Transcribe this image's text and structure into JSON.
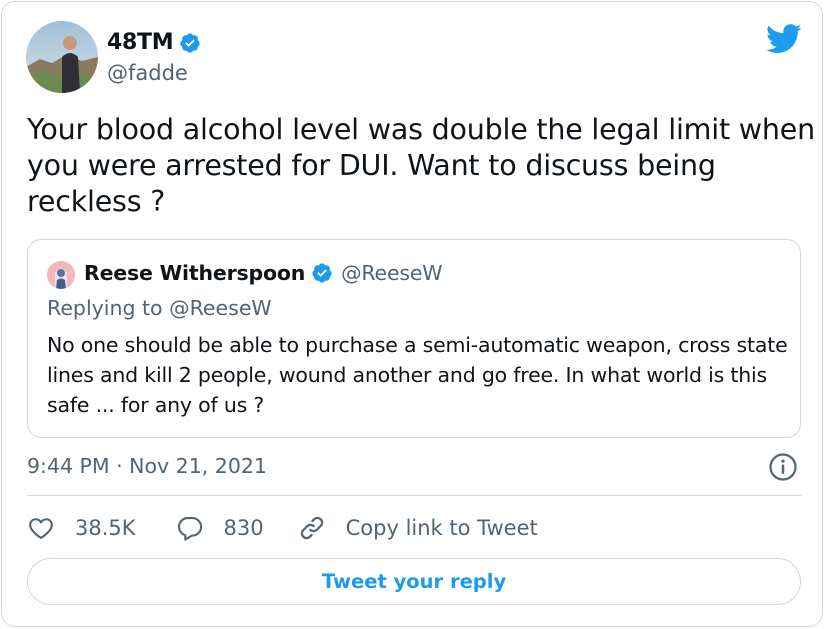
{
  "author": {
    "name": "48TM",
    "handle": "@fadde",
    "verified": true
  },
  "tweet": {
    "text": "Your blood alcohol level was double the legal limit when you were arrested for DUI. Want to discuss being reckless ?",
    "timestamp": "9:44 PM · Nov 21, 2021"
  },
  "quoted_tweet": {
    "name": "Reese Witherspoon",
    "handle": "@ReeseW",
    "verified": true,
    "replying_to": "Replying to @ReeseW",
    "text": "No one should be able to purchase a semi-automatic weapon, cross state lines and kill 2 people, wound another and go free. In what world is this safe ... for any of us ?"
  },
  "actions": {
    "likes": "38.5K",
    "replies": "830",
    "copy_link": "Copy link to Tweet"
  },
  "reply_button": "Tweet your reply",
  "icons": {
    "logo": "twitter-bird-icon",
    "verified": "verified-badge-icon",
    "info": "info-icon",
    "like": "heart-icon",
    "reply": "speech-bubble-icon",
    "link": "link-icon"
  },
  "colors": {
    "accent": "#1d9bf0",
    "text": "#0f1419",
    "muted": "#536471",
    "border": "#cfd9de"
  }
}
